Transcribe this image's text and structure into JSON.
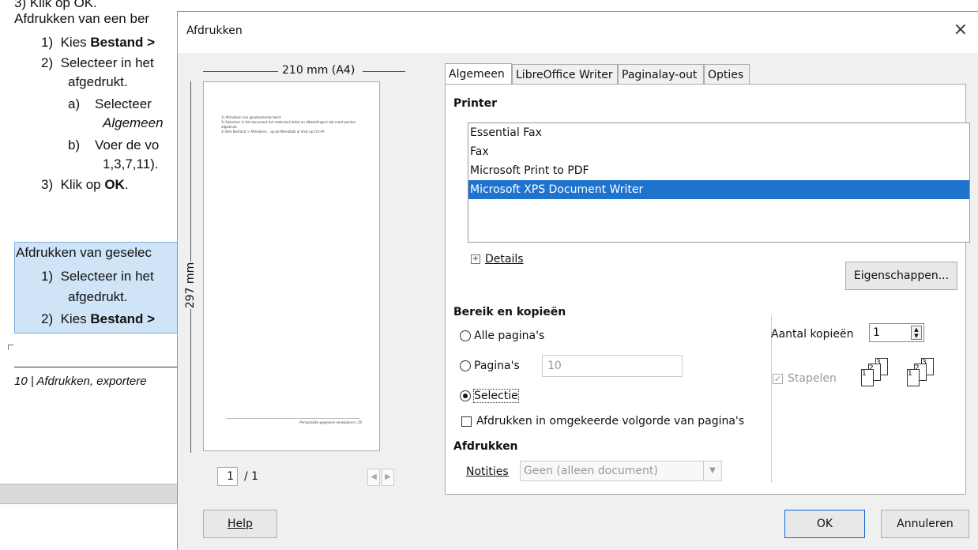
{
  "document": {
    "top_fragment": "3)  Klik op OK.",
    "heading1": "Afdrukken van een ber",
    "steps1": [
      {
        "num": "1)",
        "pre": "Kies ",
        "bold": "Bestand >"
      },
      {
        "num": "2)",
        "text": "Selecteer in het"
      },
      {
        "num": "",
        "text": "afgedrukt."
      },
      {
        "num": "a)",
        "text": "Selecteer"
      },
      {
        "num": "",
        "text": "Algemeen",
        "italic": true
      },
      {
        "num": "b)",
        "text": "Voer de vo"
      },
      {
        "num": "",
        "text": "1,3,7,11)."
      },
      {
        "num": "3)",
        "pre": "Klik op ",
        "bold": "OK",
        "post": "."
      }
    ],
    "heading2": "Afdrukken van geselec",
    "steps2": [
      {
        "num": "1)",
        "text": "Selecteer in het"
      },
      {
        "num": "",
        "text": "afgedrukt."
      },
      {
        "num": "2)",
        "pre": "Kies ",
        "bold": "Bestand >"
      }
    ],
    "footer": "10 | Afdrukken, exportere"
  },
  "dialog": {
    "title": "Afdrukken",
    "close": "×",
    "preview": {
      "width_label": "210 mm (A4)",
      "height_label": "297 mm",
      "page_lines": [
        "1)   Afdrukken van geselecteerde tekst:",
        "1)   Selecteer in het document het materiaal (tekst en afbeeldingen) dat moet worden",
        "      afgedrukt.",
        "2)   Kies Bestand > Afdrukken... op de Menubalk of druk op Ctrl+P."
      ],
      "page_footer": "Persoonlijke gegevens verwijderen | 29",
      "current_page": "1",
      "total_pages": "/ 1"
    },
    "tabs": [
      "Algemeen",
      "LibreOffice Writer",
      "Paginalay-out",
      "Opties"
    ],
    "printer_heading": "Printer",
    "printers": [
      "Essential Fax",
      "Fax",
      "Microsoft Print to PDF",
      "Microsoft XPS Document Writer"
    ],
    "details_label": "Details",
    "properties_button": "Eigenschappen...",
    "range_heading": "Bereik en kopieën",
    "all_pages": "Alle pagina's",
    "pages": "Pagina's",
    "pages_value": "10",
    "selection": "Selectie",
    "reverse_order": "Afdrukken in omgekeerde volgorde van pagina's",
    "copies_label": "Aantal kopieën",
    "copies_value": "1",
    "collate": "Stapelen",
    "print_heading": "Afdrukken",
    "notes_label": "Notities",
    "notes_value": "Geen (alleen document)",
    "help_button": "Help",
    "ok_button": "OK",
    "cancel_button": "Annuleren"
  },
  "colors": {
    "selection": "#1e73cf",
    "doc_highlight": "#cfe4f6",
    "dialog_bg": "#f0f0f0"
  },
  "icons": [
    "close-icon",
    "expand-plus-icon",
    "spin-arrows-icon",
    "dropdown-arrow-icon",
    "collate-pages-icon",
    "prev-page-icon",
    "next-page-icon"
  ]
}
